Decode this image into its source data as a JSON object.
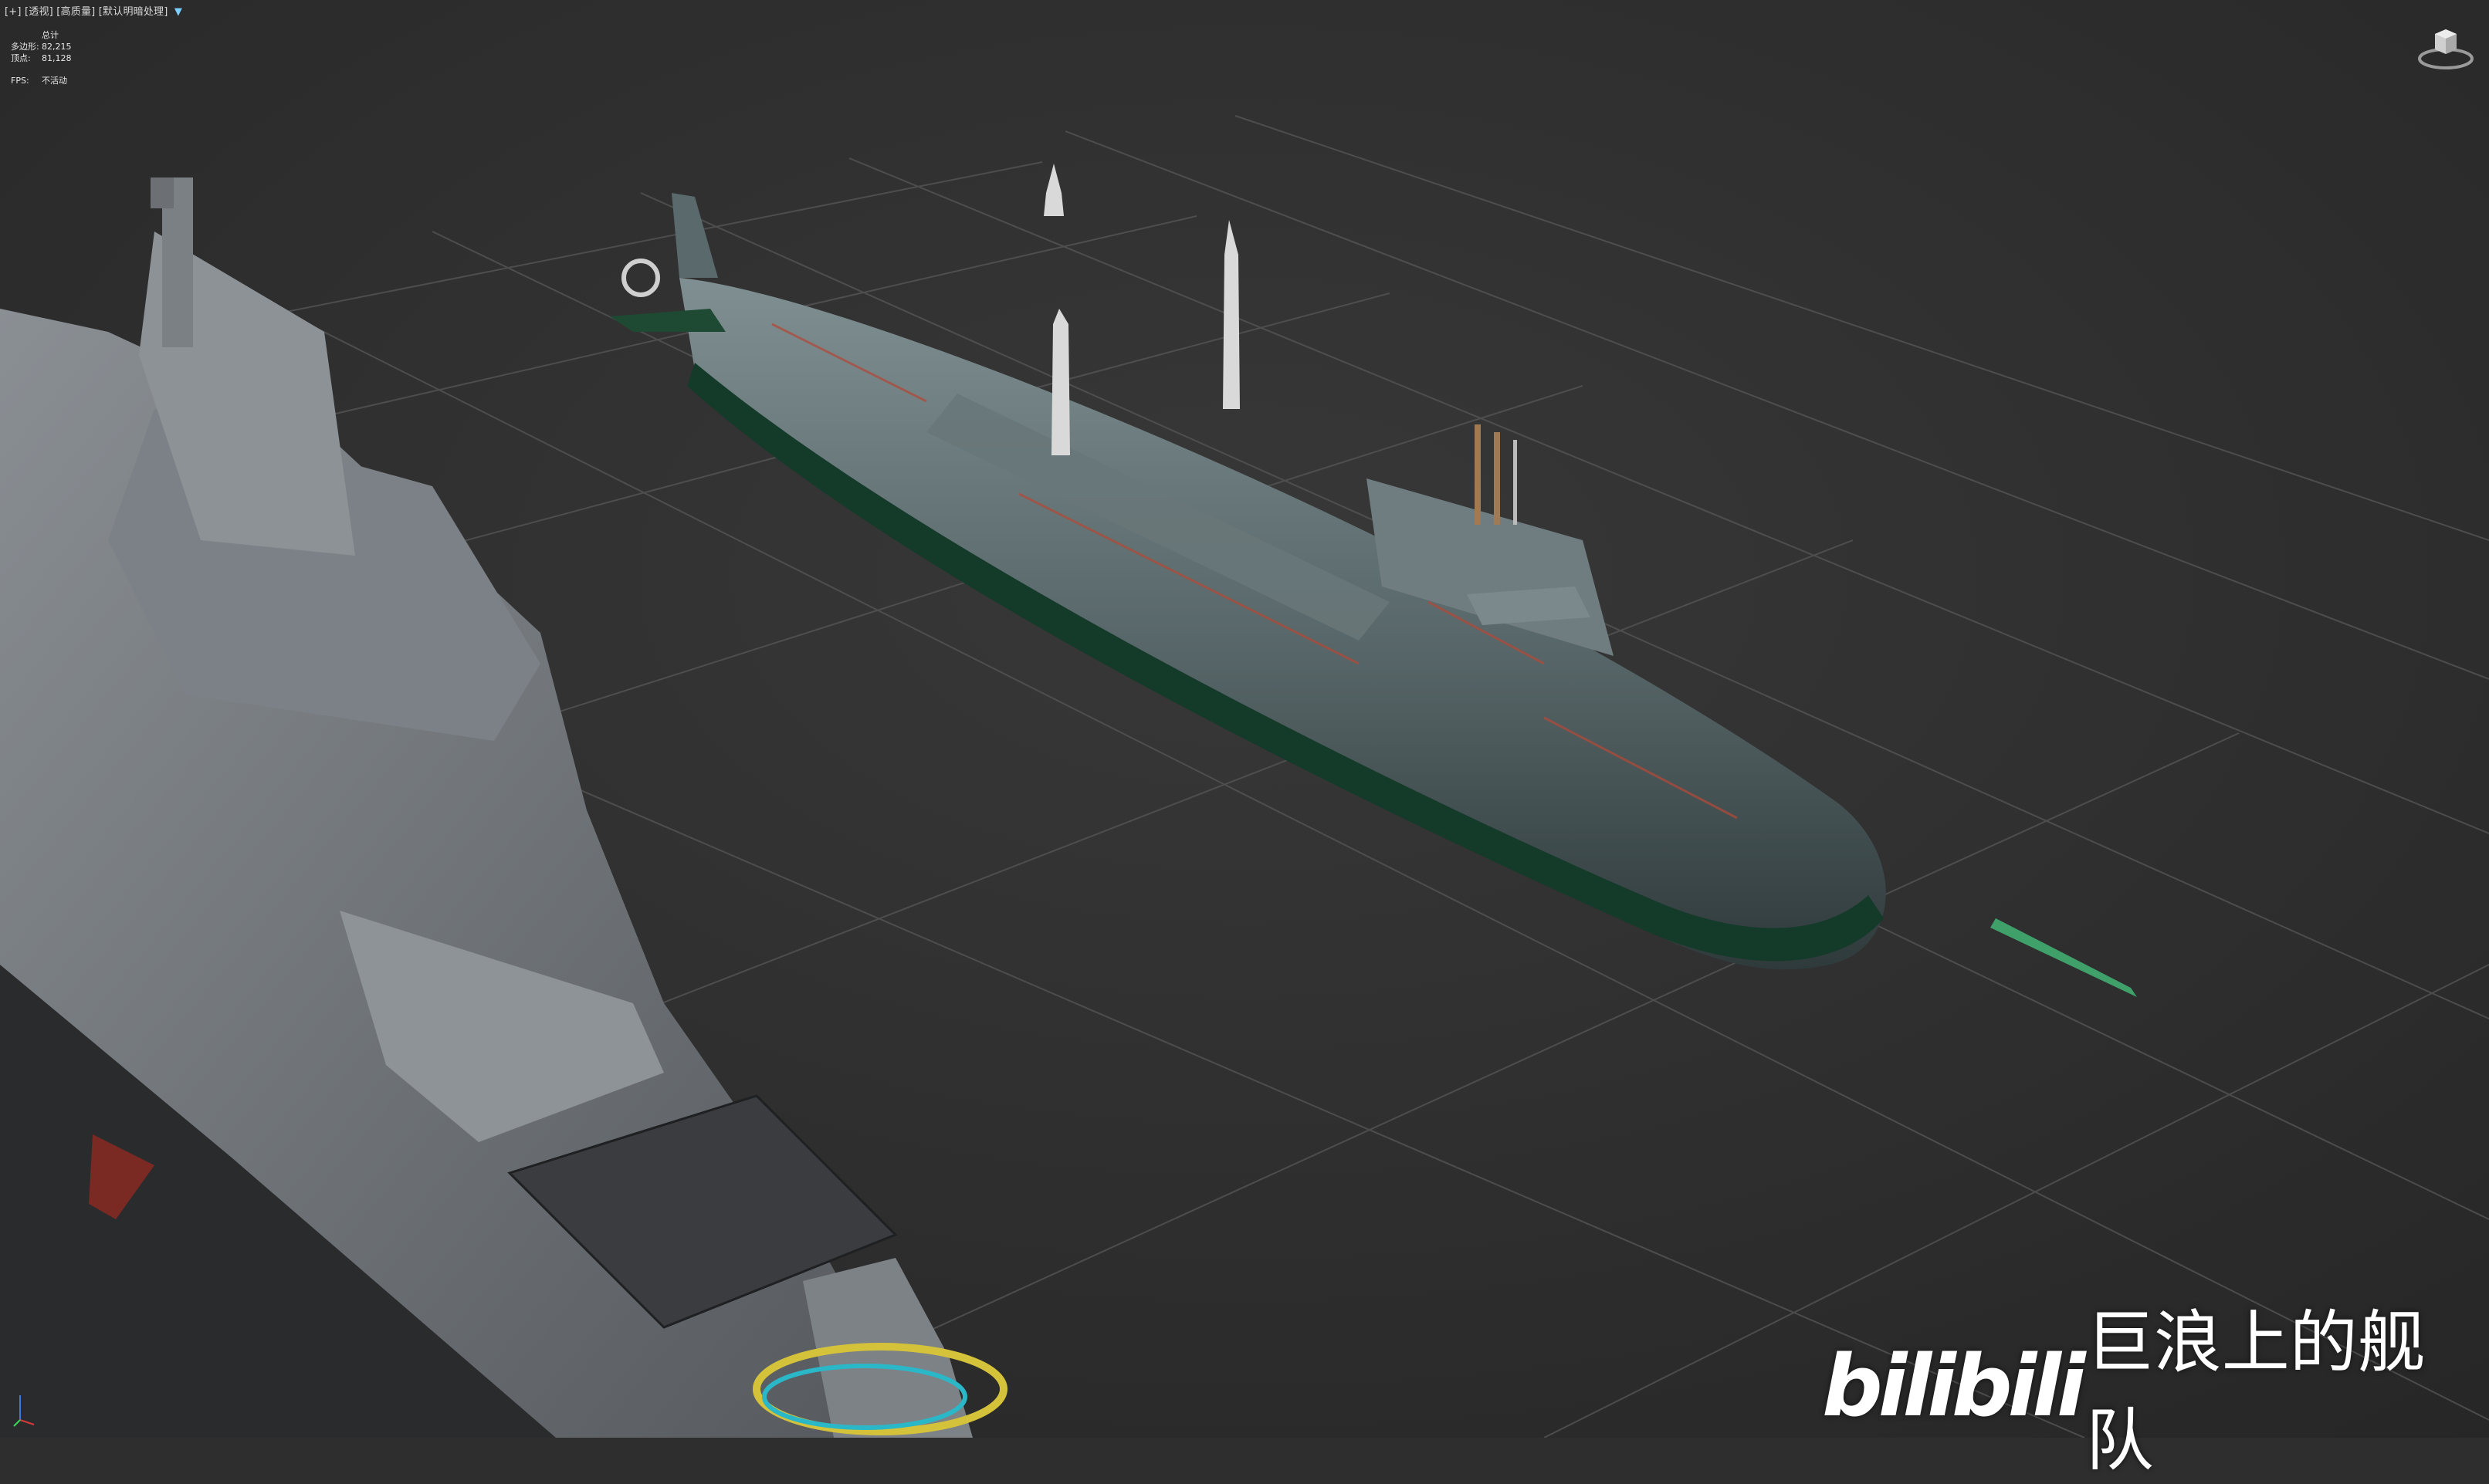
{
  "viewport": {
    "label_segments": [
      "[+]",
      "[透视]",
      "[高质量]",
      "[默认明暗处理]"
    ],
    "filter_icon": "filter-icon"
  },
  "stats": {
    "header": "总计",
    "polygons_label": "多边形:",
    "polygons_value": "82,215",
    "vertices_label": "顶点:",
    "vertices_value": "81,128",
    "fps_label": "FPS:",
    "fps_value": "不活动"
  },
  "viewcube": {
    "icon": "viewcube-icon"
  },
  "watermark": {
    "logo": "bilibili",
    "channel": "巨浪上的舰队"
  },
  "colors": {
    "viewport_bg": "#2e2e2e",
    "grid": "#505050",
    "submarine_hull": "#5c6b6e",
    "submarine_stripe": "#143a2a",
    "destroyer_gray": "#6e7378",
    "torpedo_green": "#3fa06a"
  }
}
